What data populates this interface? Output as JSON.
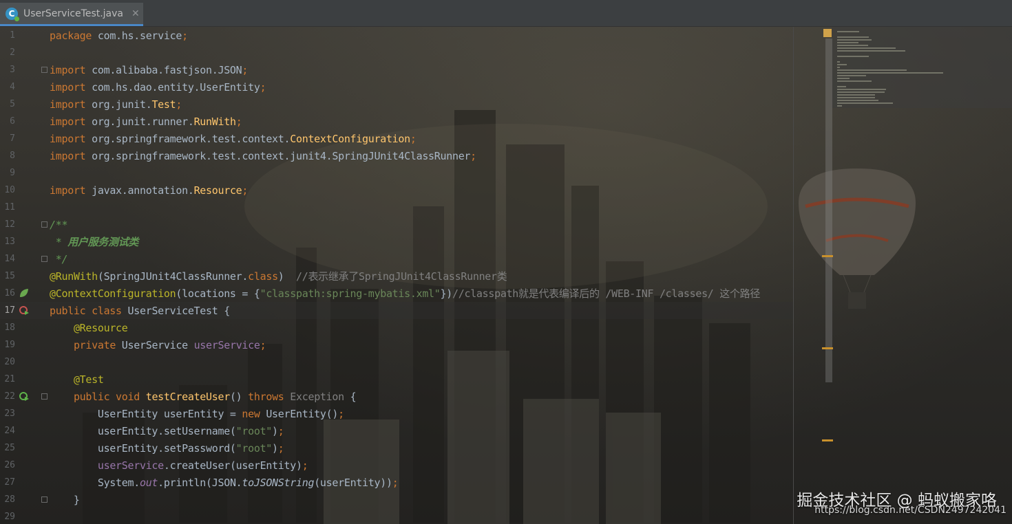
{
  "tab": {
    "icon": "java-class-icon",
    "title": "UserServiceTest.java",
    "close": "✕"
  },
  "lines": [
    {
      "n": "1",
      "segs": [
        [
          "kw",
          "package "
        ],
        [
          "",
          "com.hs.service"
        ],
        [
          "kw",
          ";"
        ]
      ]
    },
    {
      "n": "2",
      "segs": []
    },
    {
      "n": "3",
      "segs": [
        [
          "kw",
          "import "
        ],
        [
          "",
          "com.alibaba.fastjson.JSON"
        ],
        [
          "kw",
          ";"
        ]
      ]
    },
    {
      "n": "4",
      "segs": [
        [
          "kw",
          "import "
        ],
        [
          "",
          "com.hs.dao.entity.UserEntity"
        ],
        [
          "kw",
          ";"
        ]
      ]
    },
    {
      "n": "5",
      "segs": [
        [
          "kw",
          "import "
        ],
        [
          "",
          "org.junit."
        ],
        [
          "imp",
          "Test"
        ],
        [
          "kw",
          ";"
        ]
      ]
    },
    {
      "n": "6",
      "segs": [
        [
          "kw",
          "import "
        ],
        [
          "",
          "org.junit.runner."
        ],
        [
          "imp",
          "RunWith"
        ],
        [
          "kw",
          ";"
        ]
      ]
    },
    {
      "n": "7",
      "segs": [
        [
          "kw",
          "import "
        ],
        [
          "",
          "org.springframework.test.context."
        ],
        [
          "imp",
          "ContextConfiguration"
        ],
        [
          "kw",
          ";"
        ]
      ]
    },
    {
      "n": "8",
      "segs": [
        [
          "kw",
          "import "
        ],
        [
          "",
          "org.springframework.test.context.junit4.SpringJUnit4ClassRunner"
        ],
        [
          "kw",
          ";"
        ]
      ]
    },
    {
      "n": "9",
      "segs": []
    },
    {
      "n": "10",
      "segs": [
        [
          "kw",
          "import "
        ],
        [
          "",
          "javax.annotation."
        ],
        [
          "imp",
          "Resource"
        ],
        [
          "kw",
          ";"
        ]
      ]
    },
    {
      "n": "11",
      "segs": []
    },
    {
      "n": "12",
      "segs": [
        [
          "doc",
          "/**"
        ]
      ]
    },
    {
      "n": "13",
      "segs": [
        [
          "doc",
          " * "
        ],
        [
          "docb",
          "用户服务测试类"
        ]
      ]
    },
    {
      "n": "14",
      "segs": [
        [
          "doc",
          " */"
        ]
      ]
    },
    {
      "n": "15",
      "segs": [
        [
          "ann",
          "@RunWith"
        ],
        [
          "",
          "(SpringJUnit4ClassRunner."
        ],
        [
          "kw",
          "class"
        ],
        [
          "",
          ")  "
        ],
        [
          "cmt",
          "//表示继承了SpringJUnit4ClassRunner类"
        ]
      ]
    },
    {
      "n": "16",
      "segs": [
        [
          "ann",
          "@ContextConfiguration"
        ],
        [
          "",
          "(locations = {"
        ],
        [
          "str",
          "\"classpath:spring-mybatis.xml\""
        ],
        [
          "",
          "})"
        ],
        [
          "cmt",
          "//classpath就是代表编译后的 /WEB-INF /classes/ 这个路径"
        ]
      ]
    },
    {
      "n": "17",
      "segs": [
        [
          "kw",
          "public class "
        ],
        [
          "",
          "UserServiceTest {"
        ]
      ]
    },
    {
      "n": "18",
      "segs": [
        [
          "",
          "    "
        ],
        [
          "ann",
          "@Resource"
        ]
      ]
    },
    {
      "n": "19",
      "segs": [
        [
          "",
          "    "
        ],
        [
          "kw",
          "private "
        ],
        [
          "",
          "UserService "
        ],
        [
          "fld",
          "userService"
        ],
        [
          "kw",
          ";"
        ]
      ]
    },
    {
      "n": "20",
      "segs": []
    },
    {
      "n": "21",
      "segs": [
        [
          "",
          "    "
        ],
        [
          "ann",
          "@Test"
        ]
      ]
    },
    {
      "n": "22",
      "segs": [
        [
          "",
          "    "
        ],
        [
          "kw",
          "public void "
        ],
        [
          "mth",
          "testCreateUser"
        ],
        [
          "",
          "() "
        ],
        [
          "kw",
          "throws "
        ],
        [
          "cmt",
          "Exception"
        ],
        [
          "",
          " {"
        ]
      ]
    },
    {
      "n": "23",
      "segs": [
        [
          "",
          "        UserEntity userEntity = "
        ],
        [
          "kw",
          "new "
        ],
        [
          "",
          "UserEntity()"
        ],
        [
          "kw",
          ";"
        ]
      ]
    },
    {
      "n": "24",
      "segs": [
        [
          "",
          "        userEntity.setUsername("
        ],
        [
          "str",
          "\"root\""
        ],
        [
          "",
          ")"
        ],
        [
          "kw",
          ";"
        ]
      ]
    },
    {
      "n": "25",
      "segs": [
        [
          "",
          "        userEntity.setPassword("
        ],
        [
          "str",
          "\"root\""
        ],
        [
          "",
          ")"
        ],
        [
          "kw",
          ";"
        ]
      ]
    },
    {
      "n": "26",
      "segs": [
        [
          "",
          "        "
        ],
        [
          "fld",
          "userService"
        ],
        [
          "",
          ".createUser(userEntity)"
        ],
        [
          "kw",
          ";"
        ]
      ]
    },
    {
      "n": "27",
      "segs": [
        [
          "",
          "        System."
        ],
        [
          "st",
          "out"
        ],
        [
          "",
          ".println(JSON."
        ],
        [
          "static",
          "toJSONString"
        ],
        [
          "",
          "(userEntity))"
        ],
        [
          "kw",
          ";"
        ]
      ]
    },
    {
      "n": "28",
      "segs": [
        [
          "",
          "    }"
        ]
      ]
    },
    {
      "n": "29",
      "segs": []
    }
  ],
  "current_line": "17",
  "watermark": {
    "title": "掘金技术社区 @ 蚂蚁搬家咯",
    "url": "https://blog.csdn.net/CSDN2497242041"
  }
}
